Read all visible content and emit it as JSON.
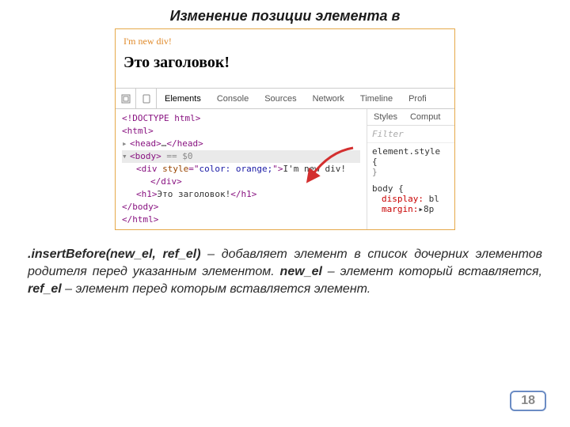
{
  "title": "Изменение позиции элемента в",
  "browser": {
    "newDivText": "I'm new div!",
    "headingText": "Это заголовок!"
  },
  "devtools": {
    "tabs": [
      "Elements",
      "Console",
      "Sources",
      "Network",
      "Timeline",
      "Profi"
    ],
    "styleTabs": [
      "Styles",
      "Comput"
    ],
    "filterPlaceholder": "Filter",
    "code": {
      "doctype": "<!DOCTYPE html>",
      "htmlOpen": "<html>",
      "headTri": "▸",
      "headOpen": "<head>",
      "headDots": "…",
      "headClose": "</head>",
      "bodyTri": "▾",
      "bodyOpen": "<body>",
      "bodySel": " == $0",
      "divOpen": "<div ",
      "styleAttr": "style",
      "styleEq": "=\"",
      "styleVal": "color: orange;",
      "styleEnd": "\">",
      "divText": "I'm new div!",
      "divClose": "</div>",
      "h1Open": "<h1>",
      "h1Text": "Это заголовок!",
      "h1Close": "</h1>",
      "bodyClose": "</body>",
      "htmlClose": "</html>"
    },
    "styles": {
      "elementStyle": "element.style {",
      "brace": "}",
      "bodySel": "body {",
      "display": "display:",
      "displayVal": " bl",
      "margin": "margin:",
      "marginVal": "▸8p"
    }
  },
  "desc": {
    "method": ".insertBefore(",
    "args": "new_el, ref_el)",
    "text1": " – добавляет элемент в  список дочерних элементов родителя перед указанным элементом. ",
    "p1": "new_el",
    "text2": " – элемент который вставляется, ",
    "p2": "ref_el",
    "text3": " – элемент перед которым вставляется элемент."
  },
  "pageNumber": "18"
}
